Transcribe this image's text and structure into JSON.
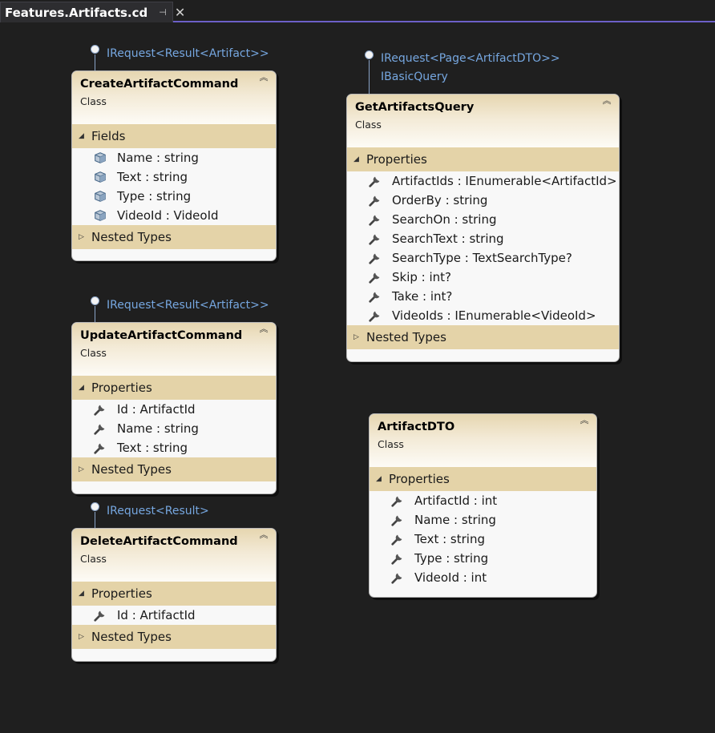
{
  "tab": {
    "title": "Features.Artifacts.cd",
    "pin_glyph": "⊣",
    "close_glyph": "✕"
  },
  "colors": {
    "accent": "#6c5fc7",
    "interface_text": "#76a7e0",
    "section_bg": "#e4d3a8",
    "canvas_bg": "#1f1f1f"
  },
  "boxes": {
    "create": {
      "interfaces": [
        "IRequest<Result<Artifact>>"
      ],
      "name": "CreateArtifactCommand",
      "kind": "Class",
      "section": "Fields",
      "members": [
        "Name : string",
        "Text : string",
        "Type : string",
        "VideoId : VideoId"
      ],
      "member_icon": "field-icon",
      "nested": "Nested Types"
    },
    "update": {
      "interfaces": [
        "IRequest<Result<Artifact>>"
      ],
      "name": "UpdateArtifactCommand",
      "kind": "Class",
      "section": "Properties",
      "members": [
        "Id : ArtifactId",
        "Name : string",
        "Text : string"
      ],
      "member_icon": "property-wrench-icon",
      "nested": "Nested Types"
    },
    "delete": {
      "interfaces": [
        "IRequest<Result>"
      ],
      "name": "DeleteArtifactCommand",
      "kind": "Class",
      "section": "Properties",
      "members": [
        "Id : ArtifactId"
      ],
      "member_icon": "property-wrench-icon",
      "nested": "Nested Types"
    },
    "get": {
      "interfaces": [
        "IRequest<Page<ArtifactDTO>>",
        "IBasicQuery"
      ],
      "name": "GetArtifactsQuery",
      "kind": "Class",
      "section": "Properties",
      "members": [
        "ArtifactIds : IEnumerable<ArtifactId>",
        "OrderBy : string",
        "SearchOn : string",
        "SearchText : string",
        "SearchType : TextSearchType?",
        "Skip : int?",
        "Take : int?",
        "VideoIds : IEnumerable<VideoId>"
      ],
      "member_icon": "property-wrench-icon",
      "nested": "Nested Types"
    },
    "dto": {
      "name": "ArtifactDTO",
      "kind": "Class",
      "section": "Properties",
      "members": [
        "ArtifactId : int",
        "Name : string",
        "Text : string",
        "Type : string",
        "VideoId : int"
      ],
      "member_icon": "property-wrench-icon"
    }
  }
}
